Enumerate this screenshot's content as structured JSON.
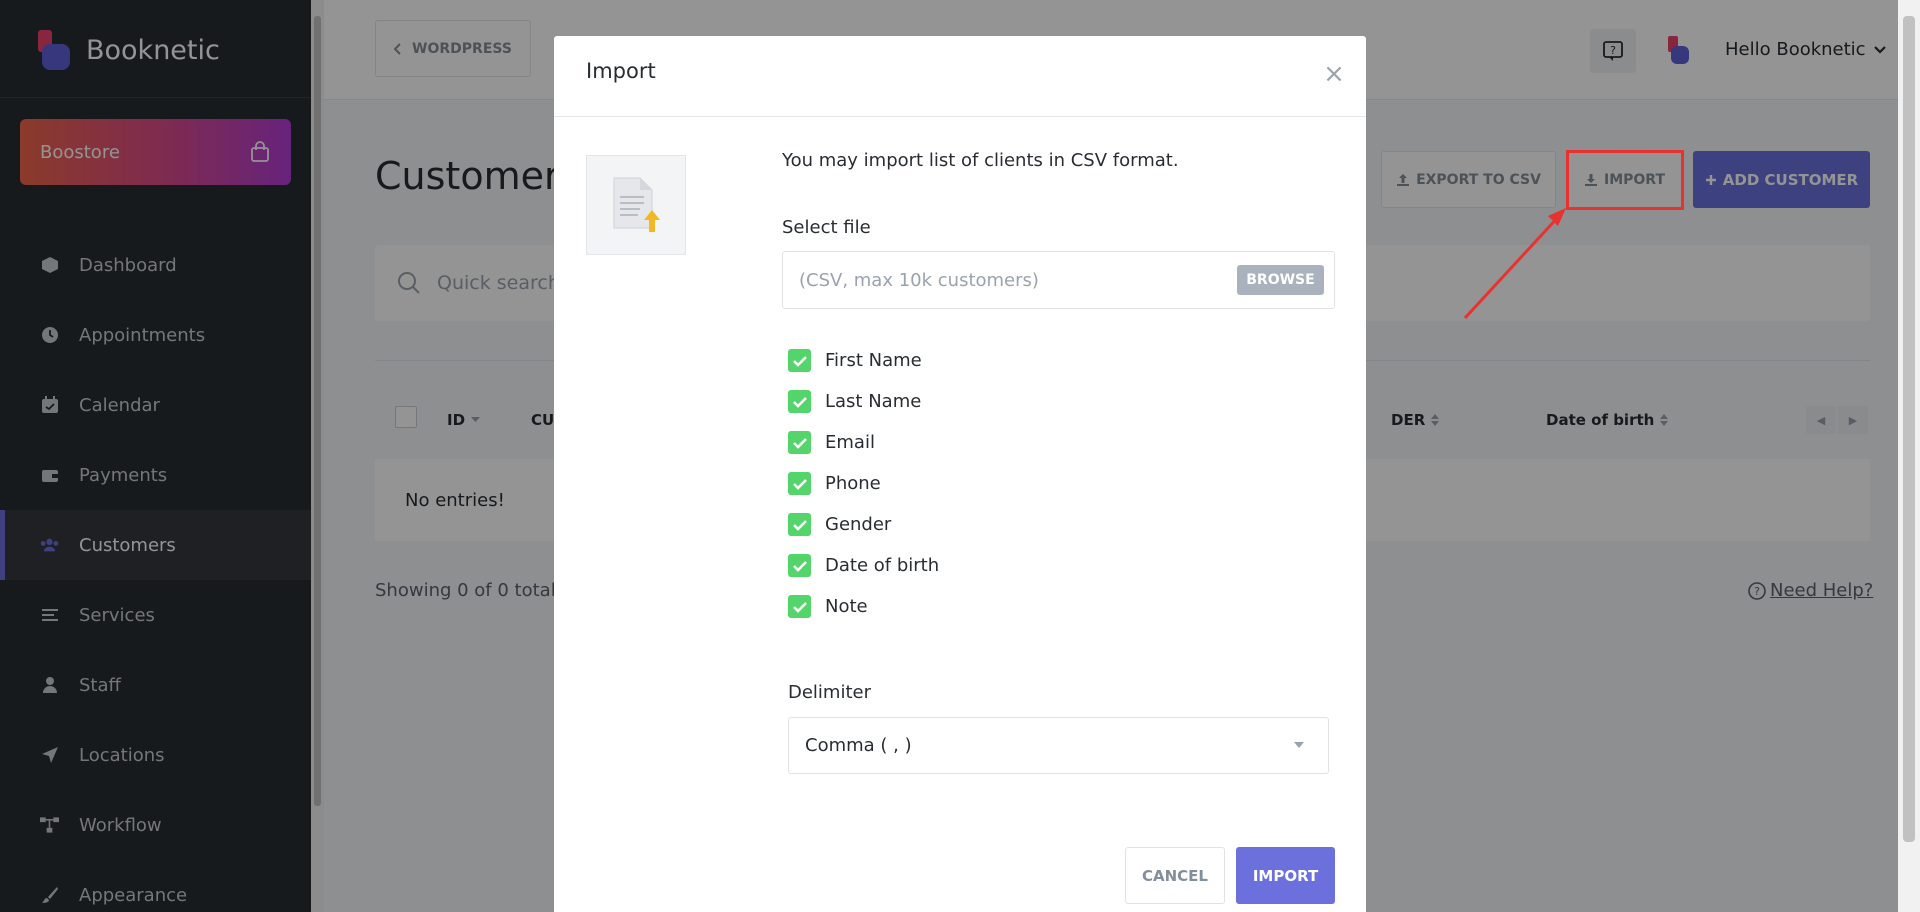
{
  "sidebar": {
    "brand": "Booknetic",
    "boostore": "Boostore",
    "items": [
      {
        "label": "Dashboard",
        "icon": "dashboard-icon"
      },
      {
        "label": "Appointments",
        "icon": "clock-icon"
      },
      {
        "label": "Calendar",
        "icon": "calendar-icon"
      },
      {
        "label": "Payments",
        "icon": "wallet-icon"
      },
      {
        "label": "Customers",
        "icon": "users-icon",
        "active": true
      },
      {
        "label": "Services",
        "icon": "list-icon"
      },
      {
        "label": "Staff",
        "icon": "user-icon"
      },
      {
        "label": "Locations",
        "icon": "location-arrow-icon"
      },
      {
        "label": "Workflow",
        "icon": "workflow-icon"
      },
      {
        "label": "Appearance",
        "icon": "brush-icon"
      }
    ]
  },
  "topbar": {
    "wordpress": "WORDPRESS",
    "greeting": "Hello Booknetic"
  },
  "page": {
    "title": "Customers",
    "export": "EXPORT TO CSV",
    "import": "IMPORT",
    "add": "ADD CUSTOMER",
    "search_placeholder": "Quick search",
    "columns": {
      "id": "ID",
      "customer": "CU",
      "gender": "DER",
      "dob": "Date of birth"
    },
    "empty": "No entries!",
    "showing": "Showing 0 of 0 total",
    "need_help": "Need Help?"
  },
  "modal": {
    "title": "Import",
    "close": "×",
    "intro": "You may import list of clients in CSV format.",
    "select_file_label": "Select file",
    "file_placeholder": "(CSV, max 10k customers)",
    "browse": "BROWSE",
    "fields": [
      "First Name",
      "Last Name",
      "Email",
      "Phone",
      "Gender",
      "Date of birth",
      "Note"
    ],
    "delimiter_label": "Delimiter",
    "delimiter_value": "Comma ( , )",
    "cancel": "CANCEL",
    "submit": "IMPORT"
  },
  "colors": {
    "accent": "#6c70dc",
    "checkbox": "#53d56c",
    "highlight": "#e8322f",
    "sidebar": "#292D32"
  }
}
